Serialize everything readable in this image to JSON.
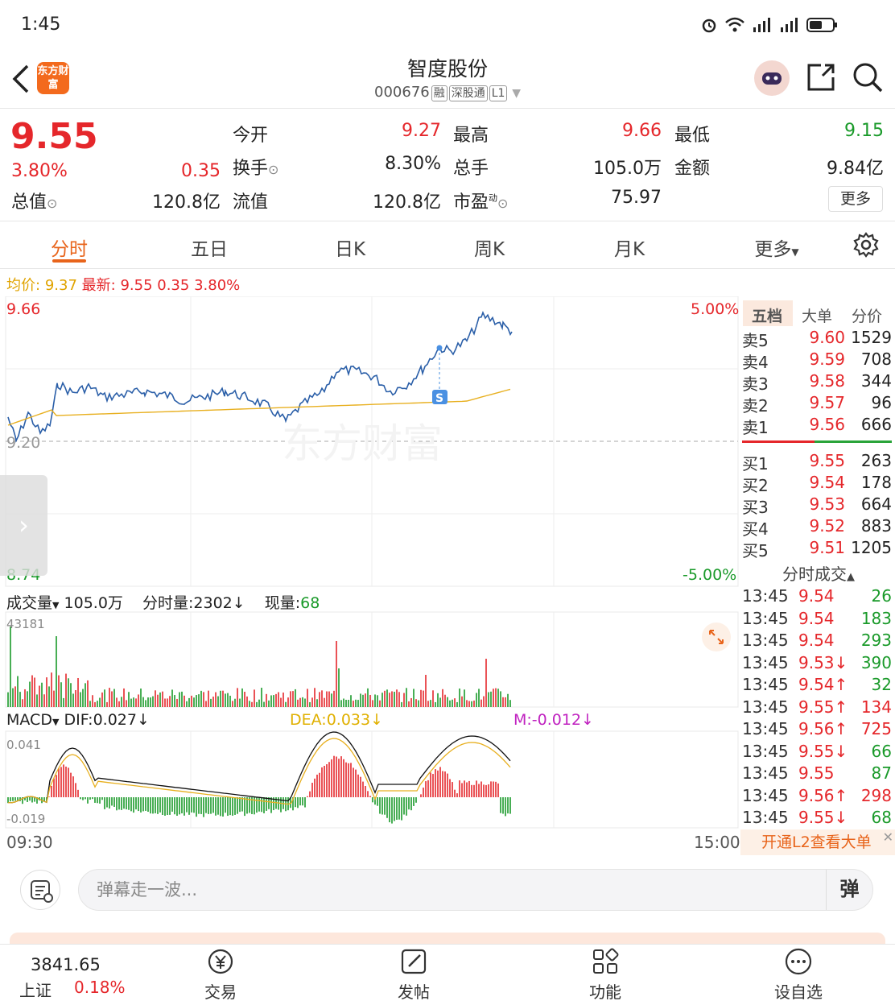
{
  "status": {
    "time": "1:45"
  },
  "header": {
    "logo_text": "东方财富",
    "title": "智度股份",
    "code": "000676",
    "tags": [
      "融",
      "深股通",
      "L1"
    ]
  },
  "quote": {
    "price": "9.55",
    "change_pct": "3.80%",
    "change": "0.35",
    "market_cap_label": "总值",
    "market_cap": "120.8亿",
    "open_label": "今开",
    "open": "9.27",
    "high_label": "最高",
    "high": "9.66",
    "low_label": "最低",
    "low": "9.15",
    "turnover_label": "换手",
    "turnover": "8.30%",
    "volume_label": "总手",
    "volume": "105.0万",
    "amount_label": "金额",
    "amount": "9.84亿",
    "float_label": "流值",
    "float_cap": "120.8亿",
    "pe_label": "市盈",
    "pe_sup": "动",
    "pe": "75.97",
    "more_label": "更多"
  },
  "tabs": [
    "分时",
    "五日",
    "日K",
    "周K",
    "月K",
    "更多"
  ],
  "avg_bar": {
    "avg_label": "均价:",
    "avg": "9.37",
    "latest_label": "最新:",
    "latest": "9.55",
    "chg": "0.35",
    "pct": "3.80%"
  },
  "chart": {
    "y_top": "9.66",
    "y_mid": "9.20",
    "y_bottom": "8.74",
    "pct_top": "5.00%",
    "pct_bottom": "-5.00%",
    "watermark": "东方财富",
    "time_start": "09:30",
    "time_end": "15:00",
    "marker": "S"
  },
  "volume_bar": {
    "label": "成交量",
    "total": "105.0万",
    "tick_label": "分时量:2302",
    "now_label": "现量:",
    "now": "68",
    "max": "43181"
  },
  "macd_bar": {
    "label": "MACD",
    "dif": "DIF:0.027",
    "dea": "DEA:0.033",
    "m": "M:-0.012",
    "top": "0.041",
    "bottom": "-0.019"
  },
  "orderbook": {
    "tabs": [
      "五档",
      "大单",
      "分价"
    ],
    "asks": [
      {
        "name": "卖5",
        "price": "9.60",
        "vol": "1529"
      },
      {
        "name": "卖4",
        "price": "9.59",
        "vol": "708"
      },
      {
        "name": "卖3",
        "price": "9.58",
        "vol": "344"
      },
      {
        "name": "卖2",
        "price": "9.57",
        "vol": "96"
      },
      {
        "name": "卖1",
        "price": "9.56",
        "vol": "666"
      }
    ],
    "bids": [
      {
        "name": "买1",
        "price": "9.55",
        "vol": "263"
      },
      {
        "name": "买2",
        "price": "9.54",
        "vol": "178"
      },
      {
        "name": "买3",
        "price": "9.53",
        "vol": "664"
      },
      {
        "name": "买4",
        "price": "9.52",
        "vol": "883"
      },
      {
        "name": "买5",
        "price": "9.51",
        "vol": "1205"
      }
    ],
    "trades_title": "分时成交",
    "trades": [
      {
        "time": "13:45",
        "price": "9.54",
        "vol": "26",
        "pc": "red",
        "vc": "green"
      },
      {
        "time": "13:45",
        "price": "9.54",
        "vol": "183",
        "pc": "red",
        "vc": "green"
      },
      {
        "time": "13:45",
        "price": "9.54",
        "vol": "293",
        "pc": "red",
        "vc": "green"
      },
      {
        "time": "13:45",
        "price": "9.53↓",
        "vol": "390",
        "pc": "red",
        "vc": "green"
      },
      {
        "time": "13:45",
        "price": "9.54↑",
        "vol": "32",
        "pc": "red",
        "vc": "green"
      },
      {
        "time": "13:45",
        "price": "9.55↑",
        "vol": "134",
        "pc": "red",
        "vc": "red"
      },
      {
        "time": "13:45",
        "price": "9.56↑",
        "vol": "725",
        "pc": "red",
        "vc": "red"
      },
      {
        "time": "13:45",
        "price": "9.55↓",
        "vol": "66",
        "pc": "red",
        "vc": "green"
      },
      {
        "time": "13:45",
        "price": "9.55",
        "vol": "87",
        "pc": "red",
        "vc": "green"
      },
      {
        "time": "13:45",
        "price": "9.56↑",
        "vol": "298",
        "pc": "red",
        "vc": "red"
      },
      {
        "time": "13:45",
        "price": "9.55↓",
        "vol": "68",
        "pc": "red",
        "vc": "green"
      }
    ],
    "l2_banner": "开通L2查看大单"
  },
  "danmu": {
    "placeholder": "弹幕走一波...",
    "send": "弹"
  },
  "nav": {
    "index_value": "3841.65",
    "index_name": "上证",
    "index_pct": "0.18%",
    "items": [
      "交易",
      "发帖",
      "功能",
      "设自选"
    ]
  }
}
